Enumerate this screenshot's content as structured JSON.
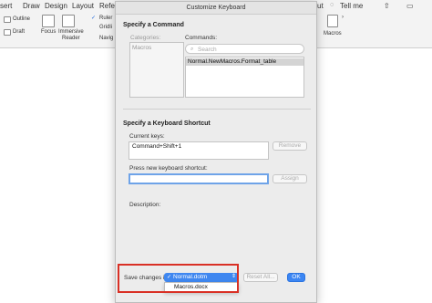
{
  "word": {
    "menu": [
      "sert",
      "Draw",
      "Design",
      "Layout",
      "Refe"
    ],
    "tell_me": "Tell me",
    "ribbon": {
      "outline": "Outline",
      "draft": "Draft",
      "focus": "Focus",
      "immersive_line1": "Immersive",
      "immersive_line2": "Reader",
      "ruler": "Ruler",
      "gridlines": "Gridli",
      "navigation": "Navig",
      "macros": "Macros"
    }
  },
  "dialog": {
    "title": "Customize Keyboard",
    "command_section": {
      "title": "Specify a Command",
      "categories_label": "Categories:",
      "categories": [
        "Macros"
      ],
      "commands_label": "Commands:",
      "search_placeholder": "Search",
      "commands": [
        "Normal.NewMacros.Format_table"
      ]
    },
    "shortcut_section": {
      "title": "Specify a Keyboard Shortcut",
      "current_keys_label": "Current keys:",
      "current_keys": [
        "Command+Shift+1"
      ],
      "remove_label": "Remove",
      "new_shortcut_label": "Press new keyboard shortcut:",
      "new_shortcut_value": "",
      "assign_label": "Assign",
      "description_label": "Description:"
    },
    "footer": {
      "save_label": "Save changes in:",
      "save_options": [
        "Normal.dotm",
        "Macros.docx"
      ],
      "selected": "Normal.dotm",
      "reset_all_label": "Reset All...",
      "ok_label": "OK"
    }
  },
  "colors": {
    "accent": "#3c86f3",
    "highlight": "#d93025"
  }
}
